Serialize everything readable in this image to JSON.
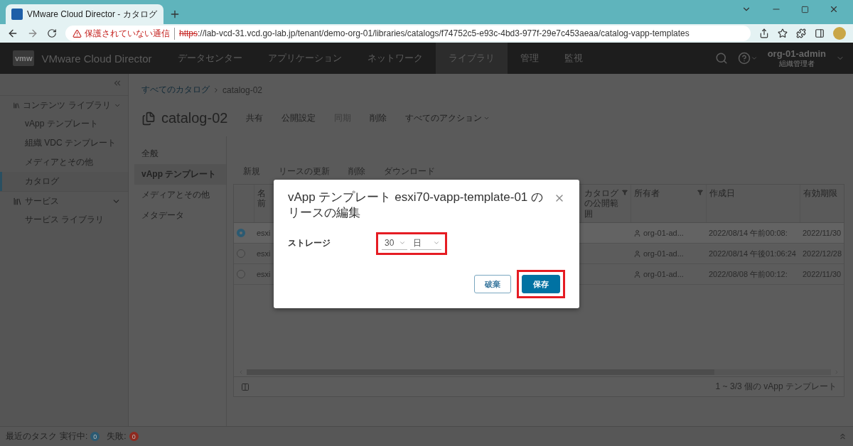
{
  "browser": {
    "tab_title": "VMware Cloud Director - カタログ",
    "security": "保護されていない通信",
    "url_scheme": "https",
    "url_rest": "://lab-vcd-31.vcd.go-lab.jp/tenant/demo-org-01/libraries/catalogs/f74752c5-e93c-4bd3-977f-29e7c453aeaa/catalog-vapp-templates"
  },
  "header": {
    "logo": "vmw",
    "product": "VMware Cloud Director",
    "nav": [
      {
        "label": "データセンター",
        "selected": false
      },
      {
        "label": "アプリケーション",
        "selected": false
      },
      {
        "label": "ネットワーク",
        "selected": false
      },
      {
        "label": "ライブラリ",
        "selected": true
      },
      {
        "label": "管理",
        "selected": false
      },
      {
        "label": "監視",
        "selected": false
      }
    ],
    "user": "org-01-admin",
    "role": "組織管理者"
  },
  "sidebar": {
    "groups": [
      {
        "label": "コンテンツ ライブラリ",
        "expanded": true,
        "children": [
          {
            "label": "vApp テンプレート",
            "selected": false
          },
          {
            "label": "組織 VDC テンプレート",
            "selected": false
          },
          {
            "label": "メディアとその他",
            "selected": false
          },
          {
            "label": "カタログ",
            "selected": true
          }
        ]
      },
      {
        "label": "サービス",
        "expanded": true,
        "children": [
          {
            "label": "サービス ライブラリ",
            "selected": false
          }
        ]
      }
    ]
  },
  "breadcrumb": [
    {
      "label": "すべてのカタログ",
      "kind": "link"
    },
    {
      "label": "catalog-02",
      "kind": "current"
    }
  ],
  "page": {
    "title": "catalog-02",
    "actions": [
      {
        "label": "共有",
        "disabled": false,
        "kind": "plain"
      },
      {
        "label": "公開設定",
        "disabled": false,
        "kind": "plain"
      },
      {
        "label": "同期",
        "disabled": true,
        "kind": "plain"
      },
      {
        "label": "削除",
        "disabled": false,
        "kind": "plain"
      },
      {
        "label": "すべてのアクション",
        "disabled": false,
        "kind": "menu"
      }
    ]
  },
  "subnav": [
    {
      "label": "全般",
      "selected": false
    },
    {
      "label": "vApp テンプレート",
      "selected": true
    },
    {
      "label": "メディアとその他",
      "selected": false
    },
    {
      "label": "メタデータ",
      "selected": false
    }
  ],
  "toolbar": [
    "新規",
    "リースの更新",
    "削除",
    "ダウンロード"
  ],
  "table": {
    "columns": [
      {
        "label": "名前",
        "filter": false
      },
      {
        "label": "カタログの公開範囲",
        "filter": true
      },
      {
        "label": "所有者",
        "filter": true
      },
      {
        "label": "作成日",
        "filter": false
      },
      {
        "label": "有効期限",
        "filter": false
      }
    ],
    "rows": [
      {
        "selected": true,
        "name": "esxi",
        "owner": "org-01-ad...",
        "created": "2022/08/14 午前00:08:",
        "expires": "2022/11/30"
      },
      {
        "selected": false,
        "name": "esxi",
        "owner": "org-01-ad...",
        "created": "2022/08/14 午後01:06:24",
        "expires": "2022/12/28"
      },
      {
        "selected": false,
        "name": "esxi",
        "owner": "org-01-ad...",
        "created": "2022/08/08 午前00:12:",
        "expires": "2022/11/30"
      }
    ],
    "footer": "1 ~ 3/3 個の vApp テンプレート"
  },
  "status_bar": {
    "label": "最近のタスク",
    "running_label": "実行中:",
    "running_count": "0",
    "failed_label": "失敗:",
    "failed_count": "0"
  },
  "dialog": {
    "title": "vApp テンプレート esxi70-vapp-template-01 のリースの編集",
    "field_label": "ストレージ",
    "selects": [
      "30",
      "日"
    ],
    "buttons": [
      {
        "label": "破棄",
        "kind": "secondary"
      },
      {
        "label": "保存",
        "kind": "primary"
      }
    ]
  }
}
